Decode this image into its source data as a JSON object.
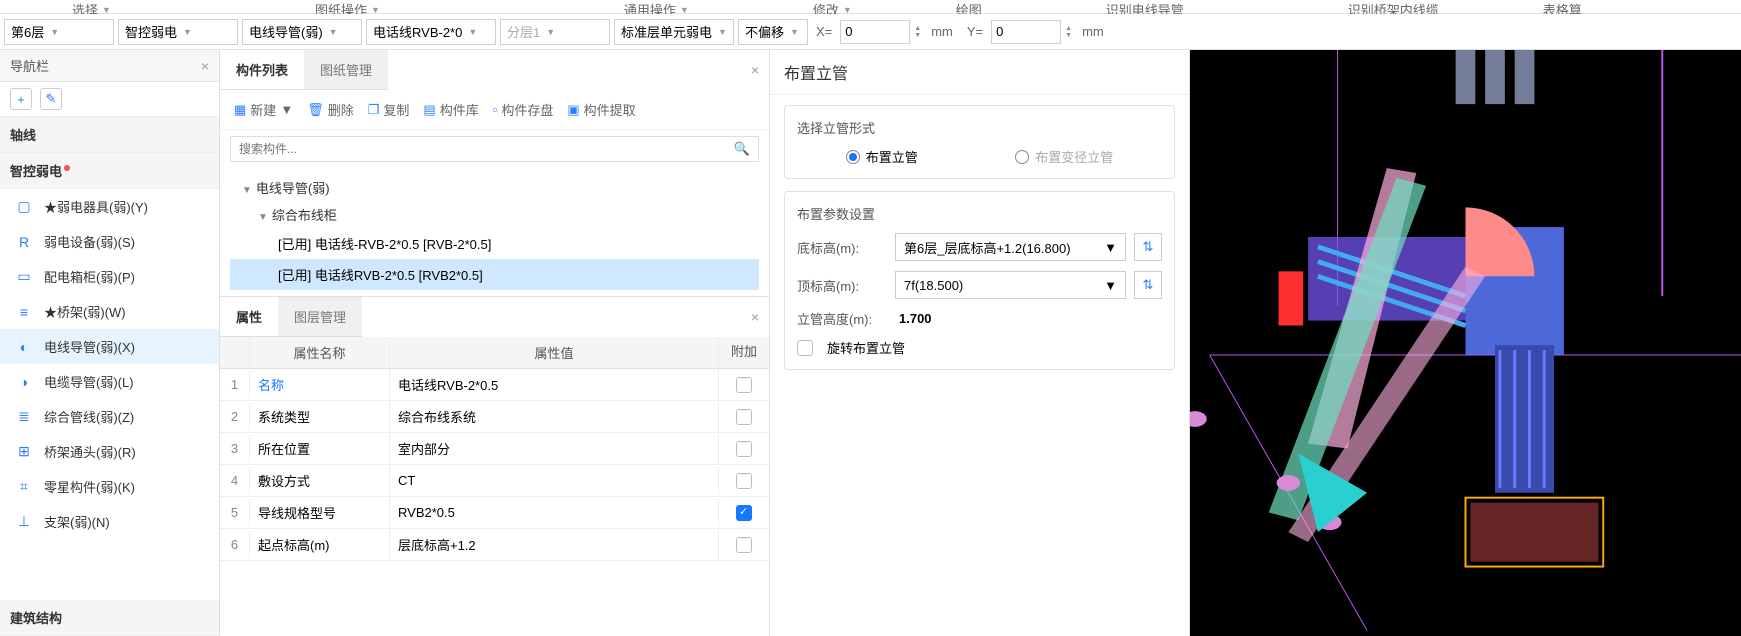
{
  "ribbon": {
    "items": [
      "选择",
      "图纸操作",
      "通用操作",
      "修改",
      "绘图",
      "识别电线导管",
      "识别桥架内线缆",
      "表格算"
    ]
  },
  "filter": {
    "floor": "第6层",
    "system": "智控弱电",
    "conduit": "电线导管(弱)",
    "cable": "电话线RVB-2*0",
    "layer": "分层1",
    "unit": "标准层单元弱电",
    "offset": "不偏移",
    "x_label": "X=",
    "x_value": "0",
    "y_label": "Y=",
    "y_value": "0",
    "unit_mm": "mm"
  },
  "nav": {
    "title": "导航栏",
    "section_axis": "轴线",
    "section_weak": "智控弱电",
    "section_struct": "建筑结构",
    "items": [
      {
        "label": "★弱电器具(弱)(Y)",
        "icon": "▢"
      },
      {
        "label": "弱电设备(弱)(S)",
        "icon": "R"
      },
      {
        "label": "配电箱柜(弱)(P)",
        "icon": "▭"
      },
      {
        "label": "★桥架(弱)(W)",
        "icon": "≡"
      },
      {
        "label": "电线导管(弱)(X)",
        "icon": "◐"
      },
      {
        "label": "电缆导管(弱)(L)",
        "icon": "◑"
      },
      {
        "label": "综合管线(弱)(Z)",
        "icon": "≣"
      },
      {
        "label": "桥架通头(弱)(R)",
        "icon": "⊞"
      },
      {
        "label": "零星构件(弱)(K)",
        "icon": "⌗"
      },
      {
        "label": "支架(弱)(N)",
        "icon": "⊥"
      }
    ]
  },
  "comp": {
    "tabs": [
      "构件列表",
      "图纸管理"
    ],
    "toolbar": {
      "new": "新建",
      "delete": "删除",
      "copy": "复制",
      "lib": "构件库",
      "save": "构件存盘",
      "extract": "构件提取"
    },
    "search_ph": "搜索构件...",
    "tree": {
      "root": "电线导管(弱)",
      "group": "综合布线柜",
      "leaf1": "[已用] 电话线-RVB-2*0.5 [RVB-2*0.5]",
      "leaf2": "[已用] 电话线RVB-2*0.5 [RVB2*0.5]"
    }
  },
  "props": {
    "tabs": [
      "属性",
      "图层管理"
    ],
    "headers": {
      "name": "属性名称",
      "value": "属性值",
      "add": "附加"
    },
    "rows": [
      {
        "idx": "1",
        "name": "名称",
        "val": "电话线RVB-2*0.5",
        "link": true,
        "chk": false
      },
      {
        "idx": "2",
        "name": "系统类型",
        "val": "综合布线系统",
        "chk": false
      },
      {
        "idx": "3",
        "name": "所在位置",
        "val": "室内部分",
        "chk": false
      },
      {
        "idx": "4",
        "name": "敷设方式",
        "val": "CT",
        "chk": false
      },
      {
        "idx": "5",
        "name": "导线规格型号",
        "val": "RVB2*0.5",
        "chk": true
      },
      {
        "idx": "6",
        "name": "起点标高(m)",
        "val": "层底标高+1.2",
        "chk": false
      }
    ]
  },
  "riser": {
    "title": "布置立管",
    "form_label": "选择立管形式",
    "opt1": "布置立管",
    "opt2": "布置变径立管",
    "param_label": "布置参数设置",
    "bottom_label": "底标高(m):",
    "bottom_value": "第6层_层底标高+1.2(16.800)",
    "top_label": "顶标高(m):",
    "top_value": "7f(18.500)",
    "height_label": "立管高度(m):",
    "height_value": "1.700",
    "rotate_label": "旋转布置立管"
  }
}
